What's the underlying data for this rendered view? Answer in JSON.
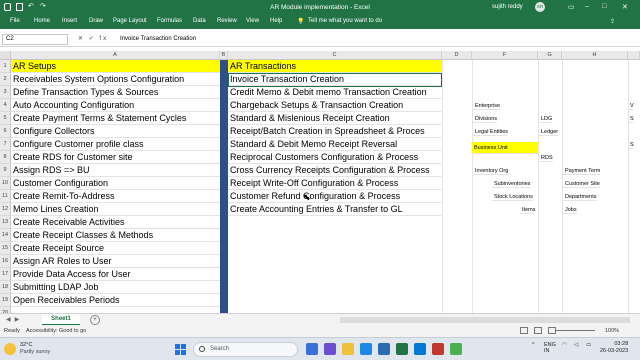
{
  "window": {
    "title": "AR Module implementation  -  Excel",
    "user": "sujith reddy",
    "initials": "SR"
  },
  "ribbon": {
    "tabs": [
      "File",
      "Home",
      "Insert",
      "Draw",
      "Page Layout",
      "Formulas",
      "Data",
      "Review",
      "View",
      "Help"
    ],
    "tell_me": "Tell me what you want to do"
  },
  "formula_bar": {
    "name_box": "C2",
    "fx": "fx",
    "content": "Invoice Transaction Creation"
  },
  "columns": [
    "A",
    "B",
    "C",
    "D",
    "E",
    "F",
    "G",
    "H"
  ],
  "rows": [
    "1",
    "2",
    "3",
    "4",
    "5",
    "6",
    "7",
    "8",
    "9",
    "10",
    "11",
    "12",
    "13",
    "14",
    "15",
    "16",
    "17",
    "18",
    "19",
    "20"
  ],
  "ar_setups": [
    "AR Setups",
    "Receivables System Options Configuration",
    "Define Transaction Types & Sources",
    "Auto Accounting Configuration",
    "Create Payment Terms & Statement Cycles",
    "Configure Collectors",
    "Configure Customer profile class",
    "Create RDS for Customer site",
    "Assign RDS => BU",
    "Customer Configuration",
    "Create Remit-To-Address",
    "Memo Lines Creation",
    "Create Receivable Activities",
    "Create Receipt Classes & Methods",
    "Create Receipt Source",
    "Assign AR Roles to User",
    "Provide Data Access for User",
    "Submitting LDAP Job",
    "Open Receivables Periods"
  ],
  "ar_transactions": [
    "AR Transactions",
    "Invoice Transaction Creation",
    "Credit Memo & Debit memo Transaction Creation",
    "Chargeback Setups & Transaction Creation",
    "Standard & Mislenious  Receipt Creation",
    "Receipt/Batch Creation in Spreadsheet & Proces",
    "Standard  & Debit Memo Receipt Reversal",
    "Reciprocal Customers Configuration & Process",
    "Cross Currency Receipts Configuration & Process",
    "Receipt Write-Off Configuration & Process",
    "Customer Refund Configuration & Process",
    "Create Accounting Entries & Transfer to GL"
  ],
  "side_notes": {
    "enterprise": "Enterprise",
    "divisions": "Divisions",
    "ldg": "LDG",
    "legal_entities": "Legal Entities",
    "ledger": "Ledger",
    "business_unit": "Business Unit",
    "rds": "RDS",
    "inventory_org": "Inventory Org",
    "payment_term": "Payment Term",
    "subinventories": "Subinventories",
    "customer_site": "Customer Site",
    "stock_locations": "Stock Locations",
    "departments": "Departments",
    "items": "Items",
    "jobs": "Jobs",
    "edge_v": "V",
    "edge_s1": "S",
    "edge_s2": "S"
  },
  "sheet_tabs": {
    "active": "Sheet1",
    "add": "+"
  },
  "status_bar": {
    "ready": "Ready",
    "accessibility": "Accessibility: Good to go",
    "zoom": "100%"
  },
  "taskbar": {
    "temp": "32°C",
    "condition": "Partly sunny",
    "search_placeholder": "Search",
    "lang_1": "ENG",
    "lang_2": "IN",
    "time": "03:28",
    "date": "26-03-2023"
  },
  "colors": {
    "excel_green": "#217346",
    "highlight_yellow": "#ffff00",
    "divider_blue": "#2f4e8a"
  }
}
